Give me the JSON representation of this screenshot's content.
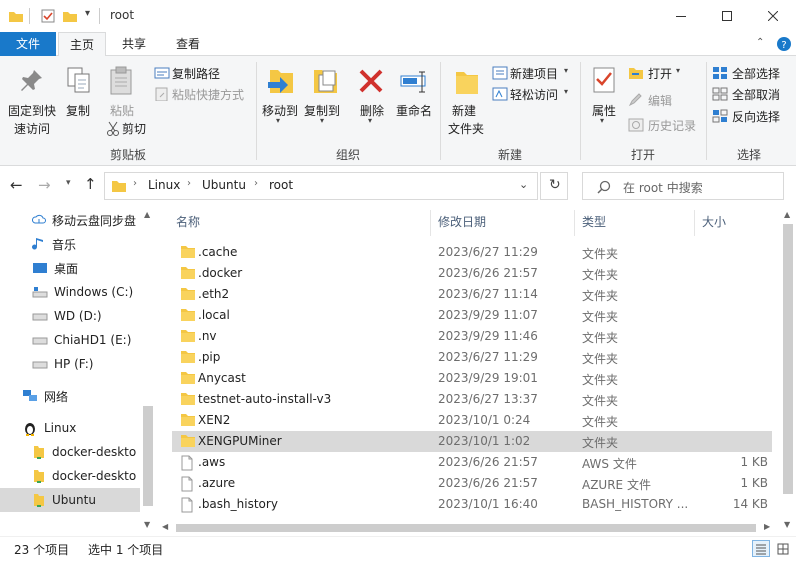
{
  "window": {
    "title": "root"
  },
  "tabs": [
    {
      "label": "文件"
    },
    {
      "label": "主页"
    },
    {
      "label": "共享"
    },
    {
      "label": "查看"
    }
  ],
  "ribbon": {
    "pin_label_1": "固定到快",
    "pin_label_2": "速访问",
    "copy": "复制",
    "paste": "粘贴",
    "copy_path": "复制路径",
    "paste_shortcut": "粘贴快捷方式",
    "cut": "剪切",
    "clipboard_group": "剪贴板",
    "move_to": "移动到",
    "copy_to": "复制到",
    "delete": "删除",
    "rename": "重命名",
    "organize_group": "组织",
    "new_folder_1": "新建",
    "new_folder_2": "文件夹",
    "new_item": "新建项目",
    "easy_access": "轻松访问",
    "new_group": "新建",
    "properties": "属性",
    "open": "打开",
    "edit": "编辑",
    "history": "历史记录",
    "open_group": "打开",
    "select_all": "全部选择",
    "select_none": "全部取消",
    "invert_selection": "反向选择",
    "select_group": "选择"
  },
  "address": {
    "crumbs": [
      "Linux",
      "Ubuntu",
      "root"
    ],
    "search_placeholder": "在 root 中搜索"
  },
  "nav": {
    "items": [
      {
        "label": "移动云盘同步盘",
        "icon": "cloud-sync-icon"
      },
      {
        "label": "音乐",
        "icon": "music-icon"
      },
      {
        "label": "桌面",
        "icon": "desktop-icon"
      },
      {
        "label": "Windows (C:)",
        "icon": "drive-icon"
      },
      {
        "label": "WD (D:)",
        "icon": "drive-icon"
      },
      {
        "label": "ChiaHD1 (E:)",
        "icon": "drive-icon"
      },
      {
        "label": "HP (F:)",
        "icon": "drive-icon"
      },
      {
        "label": "网络",
        "icon": "network-icon"
      },
      {
        "label": "Linux",
        "icon": "linux-icon"
      },
      {
        "label": "docker-deskto",
        "icon": "linux-folder-icon"
      },
      {
        "label": "docker-deskto",
        "icon": "linux-folder-icon"
      },
      {
        "label": "Ubuntu",
        "icon": "linux-folder-icon"
      }
    ]
  },
  "columns": {
    "name": "名称",
    "date": "修改日期",
    "type": "类型",
    "size": "大小"
  },
  "files": [
    {
      "name": ".cache",
      "date": "2023/6/27 11:29",
      "type": "文件夹",
      "size": "",
      "kind": "folder"
    },
    {
      "name": ".docker",
      "date": "2023/6/26 21:57",
      "type": "文件夹",
      "size": "",
      "kind": "folder"
    },
    {
      "name": ".eth2",
      "date": "2023/6/27 11:14",
      "type": "文件夹",
      "size": "",
      "kind": "folder"
    },
    {
      "name": ".local",
      "date": "2023/9/29 11:07",
      "type": "文件夹",
      "size": "",
      "kind": "folder"
    },
    {
      "name": ".nv",
      "date": "2023/9/29 11:46",
      "type": "文件夹",
      "size": "",
      "kind": "folder"
    },
    {
      "name": ".pip",
      "date": "2023/6/27 11:29",
      "type": "文件夹",
      "size": "",
      "kind": "folder"
    },
    {
      "name": "Anycast",
      "date": "2023/9/29 19:01",
      "type": "文件夹",
      "size": "",
      "kind": "folder"
    },
    {
      "name": "testnet-auto-install-v3",
      "date": "2023/6/27 13:37",
      "type": "文件夹",
      "size": "",
      "kind": "folder"
    },
    {
      "name": "XEN2",
      "date": "2023/10/1 0:24",
      "type": "文件夹",
      "size": "",
      "kind": "folder"
    },
    {
      "name": "XENGPUMiner",
      "date": "2023/10/1 1:02",
      "type": "文件夹",
      "size": "",
      "kind": "folder"
    },
    {
      "name": ".aws",
      "date": "2023/6/26 21:57",
      "type": "AWS 文件",
      "size": "1 KB",
      "kind": "file"
    },
    {
      "name": ".azure",
      "date": "2023/6/26 21:57",
      "type": "AZURE 文件",
      "size": "1 KB",
      "kind": "file"
    },
    {
      "name": ".bash_history",
      "date": "2023/10/1 16:40",
      "type": "BASH_HISTORY ...",
      "size": "14 KB",
      "kind": "file"
    }
  ],
  "status": {
    "count": "23 个项目",
    "selected": "选中 1 个项目"
  },
  "colors": {
    "accent": "#1979ca",
    "folder": "#f4c744",
    "selection": "#d9d9d9",
    "nav_selection": "#cce8ff"
  }
}
